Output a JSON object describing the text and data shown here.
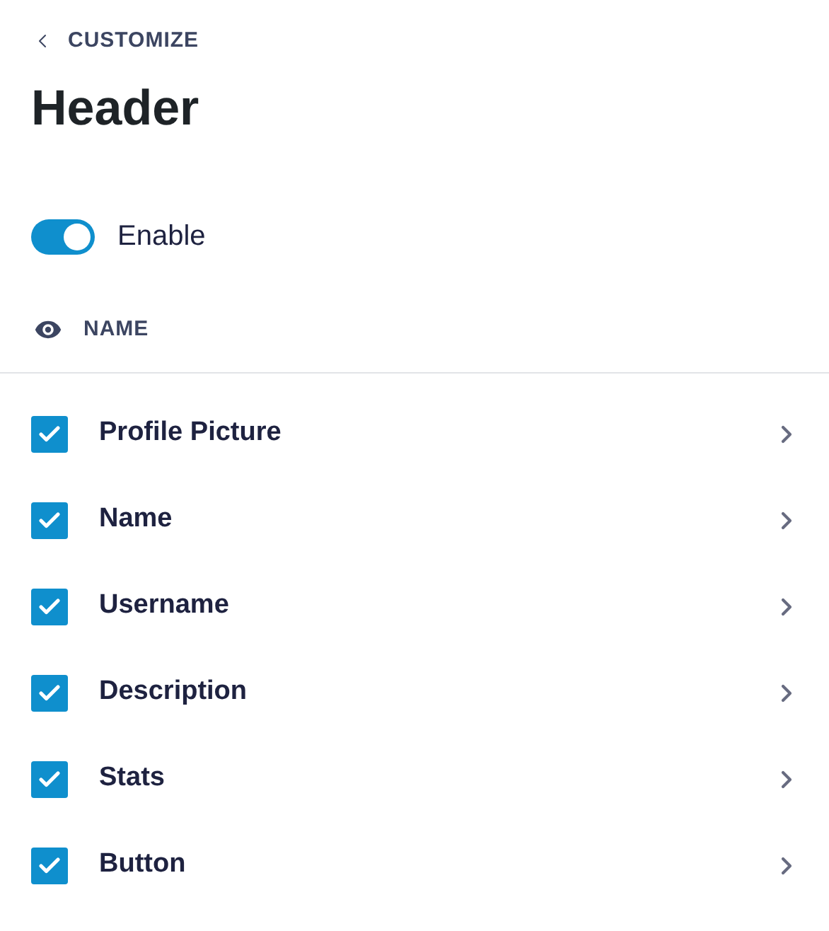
{
  "back": {
    "label": "CUSTOMIZE"
  },
  "title": "Header",
  "toggle": {
    "label": "Enable",
    "on": true
  },
  "section": {
    "label": "NAME"
  },
  "items": [
    {
      "label": "Profile Picture",
      "checked": true
    },
    {
      "label": "Name",
      "checked": true
    },
    {
      "label": "Username",
      "checked": true
    },
    {
      "label": "Description",
      "checked": true
    },
    {
      "label": "Stats",
      "checked": true
    },
    {
      "label": "Button",
      "checked": true
    }
  ]
}
